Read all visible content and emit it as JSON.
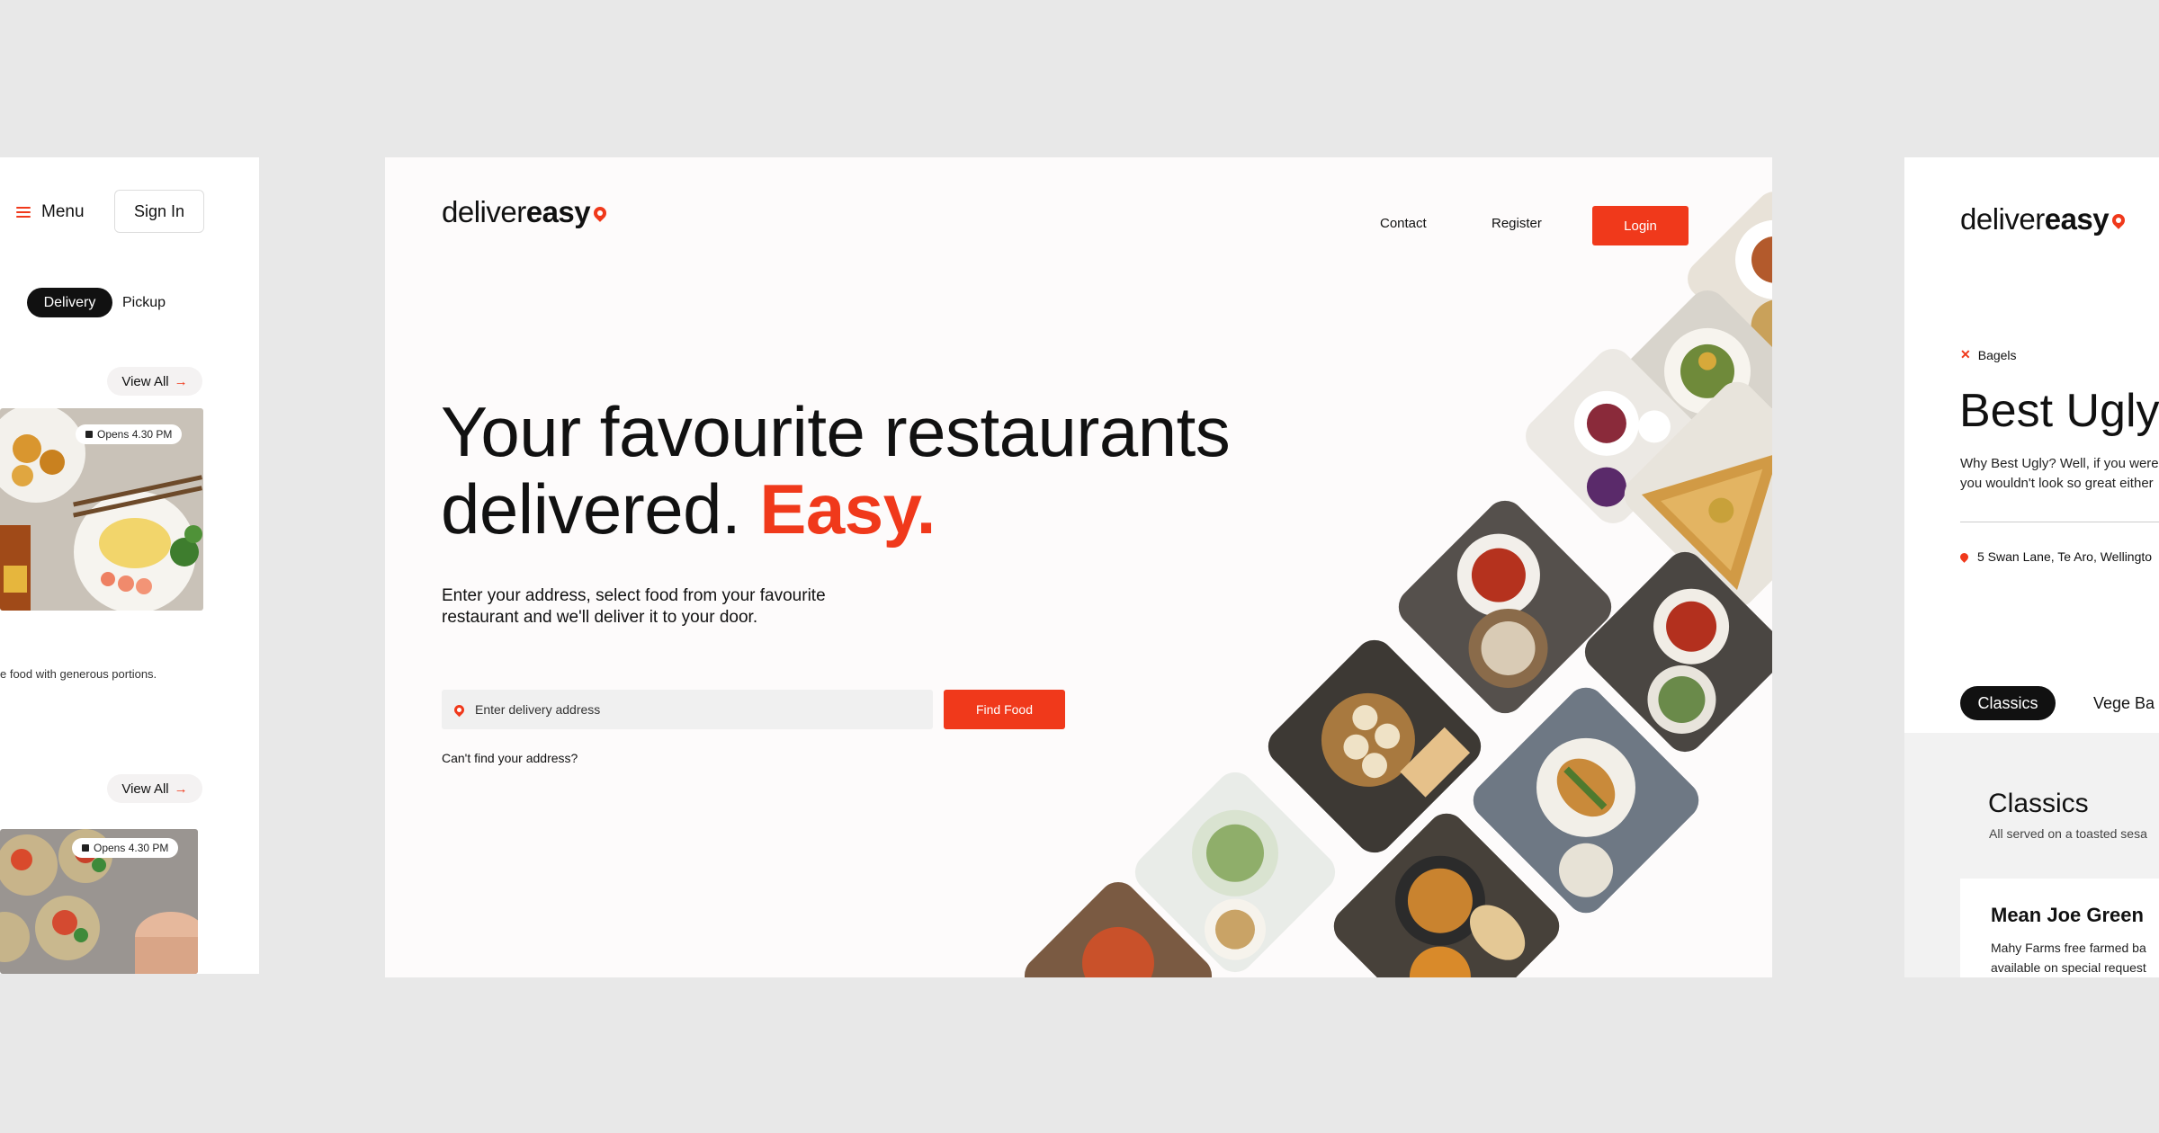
{
  "left_panel": {
    "menu_label": "Menu",
    "signin_label": "Sign In",
    "tabs": [
      {
        "label": "Delivery"
      },
      {
        "label": "Pickup"
      }
    ],
    "view_all": "View All",
    "badge_text": "Opens 4.30 PM",
    "description_fragment": "e food with generous portions."
  },
  "center": {
    "logo_light": "deliver",
    "logo_bold": "easy",
    "nav": {
      "contact": "Contact",
      "register": "Register",
      "login": "Login"
    },
    "headline_line1": "Your favourite restaurants",
    "headline_line2": "delivered.",
    "headline_accent": "Easy.",
    "subtext": "Enter your address, select food from your favourite restaurant and we'll deliver it to your door.",
    "address_placeholder": "Enter delivery address",
    "find_food": "Find Food",
    "cant_find": "Can't find your address?"
  },
  "right_panel": {
    "category": "Bagels",
    "title": "Best Ugly",
    "desc_line1": "Why Best Ugly? Well, if you were",
    "desc_line2": "you wouldn't look so great either",
    "address": "5 Swan Lane, Te Aro, Wellingto",
    "tabs": [
      {
        "label": "Classics"
      },
      {
        "label": "Vege Ba"
      }
    ],
    "section_title": "Classics",
    "section_sub": "All served on a toasted sesa",
    "item_name": "Mean Joe Green",
    "item_desc_line1": "Mahy Farms free farmed ba",
    "item_desc_line2": "available on special request"
  },
  "colors": {
    "accent": "#f0391b",
    "dark": "#111111",
    "background": "#e8e8e8"
  }
}
